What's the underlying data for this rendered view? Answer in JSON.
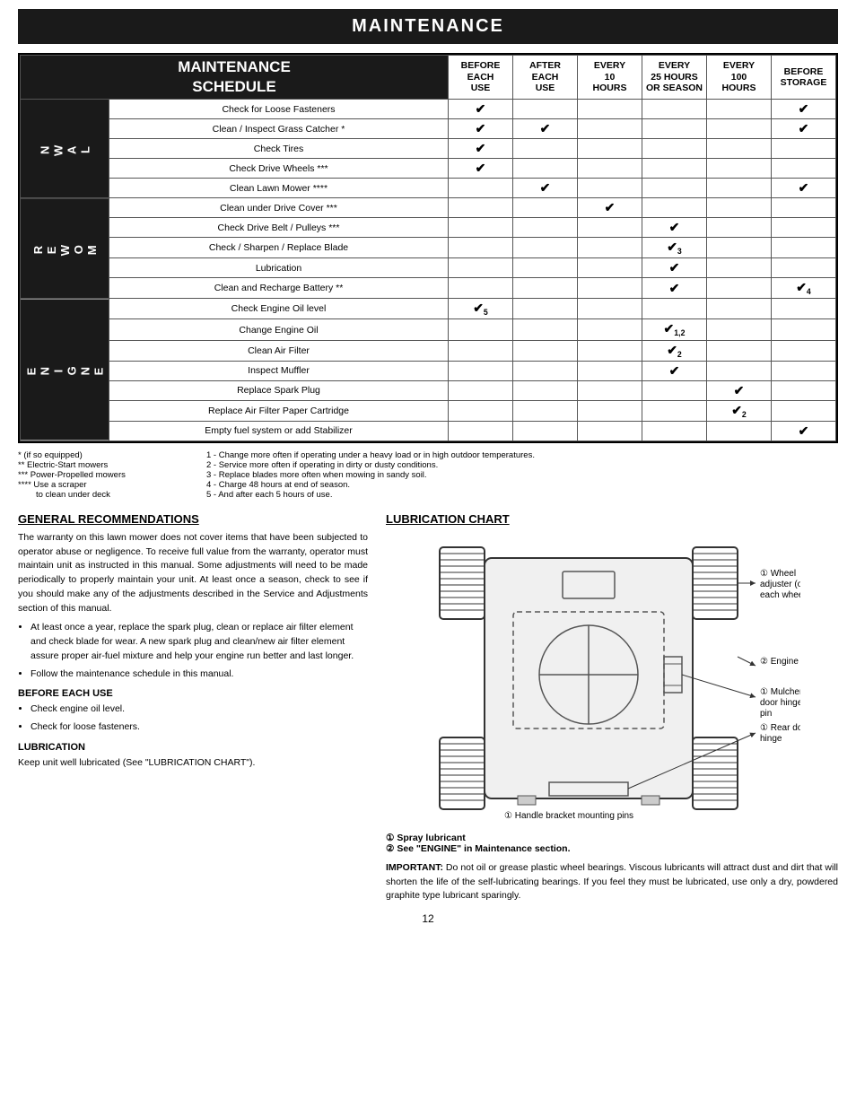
{
  "page": {
    "title": "MAINTENANCE",
    "page_number": "12"
  },
  "maintenance_schedule": {
    "title_line1": "MAINTENANCE",
    "title_line2": "SCHEDULE",
    "columns": [
      "BEFORE EACH USE",
      "AFTER EACH USE",
      "EVERY 10 HOURS",
      "EVERY 25 HOURS OR SEASON",
      "EVERY 100 HOURS",
      "BEFORE STORAGE"
    ],
    "sections": [
      {
        "label": "L\nA\nW\nN",
        "rows": [
          {
            "task": "Check for Loose Fasteners",
            "before_each": true,
            "after_each": false,
            "every10": false,
            "every25": false,
            "every100": false,
            "before_storage": true,
            "notes": ""
          },
          {
            "task": "Clean / Inspect Grass Catcher *",
            "before_each": true,
            "after_each": true,
            "every10": false,
            "every25": false,
            "every100": false,
            "before_storage": true,
            "notes": ""
          },
          {
            "task": "Check Tires",
            "before_each": true,
            "after_each": false,
            "every10": false,
            "every25": false,
            "every100": false,
            "before_storage": false,
            "notes": ""
          },
          {
            "task": "Check Drive Wheels ***",
            "before_each": true,
            "after_each": false,
            "every10": false,
            "every25": false,
            "every100": false,
            "before_storage": false,
            "notes": ""
          },
          {
            "task": "Clean Lawn Mower ****",
            "before_each": false,
            "after_each": true,
            "every10": false,
            "every25": false,
            "every100": false,
            "before_storage": true,
            "notes": ""
          }
        ]
      },
      {
        "label": "M\nO\nW\nE\nR",
        "rows": [
          {
            "task": "Clean under Drive Cover ***",
            "before_each": false,
            "after_each": false,
            "every10": true,
            "every25": false,
            "every100": false,
            "before_storage": false,
            "notes": ""
          },
          {
            "task": "Check Drive Belt / Pulleys ***",
            "before_each": false,
            "after_each": false,
            "every10": false,
            "every25": true,
            "every100": false,
            "before_storage": false,
            "notes": ""
          },
          {
            "task": "Check / Sharpen / Replace Blade",
            "before_each": false,
            "after_each": false,
            "every10": false,
            "every25": true,
            "every100": false,
            "before_storage": false,
            "notes": "3"
          },
          {
            "task": "Lubrication",
            "before_each": false,
            "after_each": false,
            "every10": false,
            "every25": true,
            "every100": false,
            "before_storage": false,
            "notes": ""
          },
          {
            "task": "Clean and Recharge Battery **",
            "before_each": false,
            "after_each": false,
            "every10": false,
            "every25": true,
            "every100": false,
            "before_storage": true,
            "notes": "4"
          }
        ]
      },
      {
        "label": "E\nN\nG\nI\nN\nE",
        "rows": [
          {
            "task": "Check Engine Oil level",
            "before_each": true,
            "after_each": false,
            "every10": false,
            "every25": false,
            "every100": false,
            "before_storage": false,
            "notes": "5"
          },
          {
            "task": "Change Engine Oil",
            "before_each": false,
            "after_each": false,
            "every10": false,
            "every25": true,
            "every100": false,
            "before_storage": false,
            "notes": "1,2"
          },
          {
            "task": "Clean Air Filter",
            "before_each": false,
            "after_each": false,
            "every10": false,
            "every25": true,
            "every100": false,
            "before_storage": false,
            "notes": "2"
          },
          {
            "task": "Inspect Muffler",
            "before_each": false,
            "after_each": false,
            "every10": false,
            "every25": true,
            "every100": false,
            "before_storage": false,
            "notes": ""
          },
          {
            "task": "Replace Spark Plug",
            "before_each": false,
            "after_each": false,
            "every10": false,
            "every25": false,
            "every100": true,
            "before_storage": false,
            "notes": ""
          },
          {
            "task": "Replace Air Filter Paper Cartridge",
            "before_each": false,
            "after_each": false,
            "every10": false,
            "every25": false,
            "every100": true,
            "before_storage": false,
            "notes": "2"
          },
          {
            "task": "Empty fuel system or add Stabilizer",
            "before_each": false,
            "after_each": false,
            "every10": false,
            "every25": false,
            "every100": false,
            "before_storage": true,
            "notes": ""
          }
        ]
      }
    ]
  },
  "footnotes": {
    "left": [
      "* (if so equipped)",
      "** Electric-Start mowers",
      "*** Power-Propelled mowers",
      "**** Use a scraper",
      "     to clean under deck"
    ],
    "right": [
      "1 - Change more often if operating under a heavy load or in high outdoor temperatures.",
      "2 - Service more often if operating in dirty or dusty conditions.",
      "3 - Replace blades more often when mowing in sandy soil.",
      "4 - Charge 48 hours at end of season.",
      "5 - And after each 5 hours of use."
    ]
  },
  "general_recommendations": {
    "title": "GENERAL RECOMMENDATIONS",
    "body": "The warranty on this lawn mower does not cover items that have been subjected to operator abuse or negligence.  To receive full value from the warranty, operator must maintain unit as instructed in this manual.  Some adjustments will need to be made periodically to properly maintain your unit.  At least once a season, check to see if you should make any of the adjustments described in the Service and Adjustments section of this manual.",
    "bullets": [
      "At least once a year, replace the spark plug, clean or replace air filter element and check blade for wear.  A new spark plug and clean/new air filter element assure proper air-fuel mixture and help your engine run better and last longer.",
      "Follow the maintenance schedule in this manual."
    ],
    "before_each_use_title": "BEFORE EACH USE",
    "before_each_use_items": [
      "Check engine oil level.",
      "Check for loose fasteners."
    ],
    "lubrication_title": "LUBRICATION",
    "lubrication_body": "Keep unit well lubricated (See \"LUBRICATION CHART\")."
  },
  "lubrication_chart": {
    "title": "LUBRICATION CHART",
    "labels": [
      {
        "num": "①",
        "text": "Wheel adjuster (on each wheel)"
      },
      {
        "num": "②",
        "text": "Engine oil"
      },
      {
        "num": "①",
        "text": "Mulcher door hinge pin"
      },
      {
        "num": "①",
        "text": "Rear door hinge"
      },
      {
        "num": "①",
        "text": "Handle bracket mounting pins"
      }
    ],
    "note1": "① Spray lubricant",
    "note2": "② See \"ENGINE\" in Maintenance section.",
    "important_title": "IMPORTANT:",
    "important_text": " Do not oil or grease plastic wheel bearings.  Viscous lubricants will attract dust and dirt that will shorten the life of the self-lubricating bearings.  If you feel they must be lubricated, use only a dry, powdered graphite type lubricant sparingly."
  }
}
